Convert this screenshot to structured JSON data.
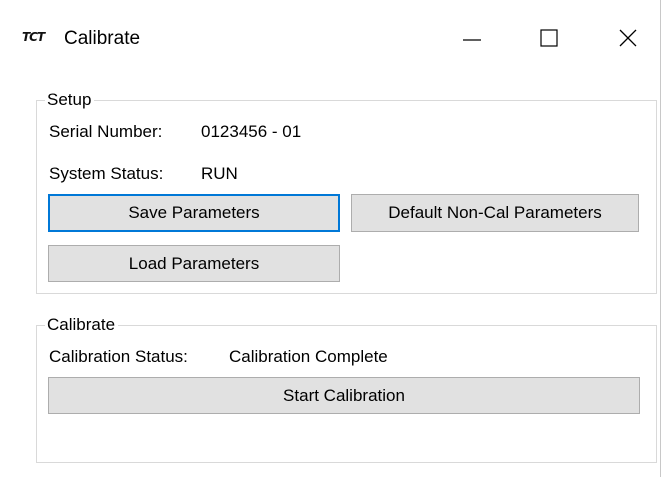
{
  "window": {
    "app_icon_text": "TCT",
    "title": "Calibrate"
  },
  "setup": {
    "group_label": "Setup",
    "serial_label": "Serial Number:",
    "serial_value": "0123456 - 01",
    "status_label": "System Status:",
    "status_value": "RUN",
    "save_button": "Save Parameters",
    "default_button": "Default Non-Cal Parameters",
    "load_button": "Load Parameters"
  },
  "calibrate": {
    "group_label": "Calibrate",
    "status_label": "Calibration Status:",
    "status_value": "Calibration Complete",
    "start_button": "Start Calibration"
  },
  "icons": {
    "minimize": "minimize-icon",
    "maximize": "maximize-icon",
    "close": "close-icon"
  }
}
